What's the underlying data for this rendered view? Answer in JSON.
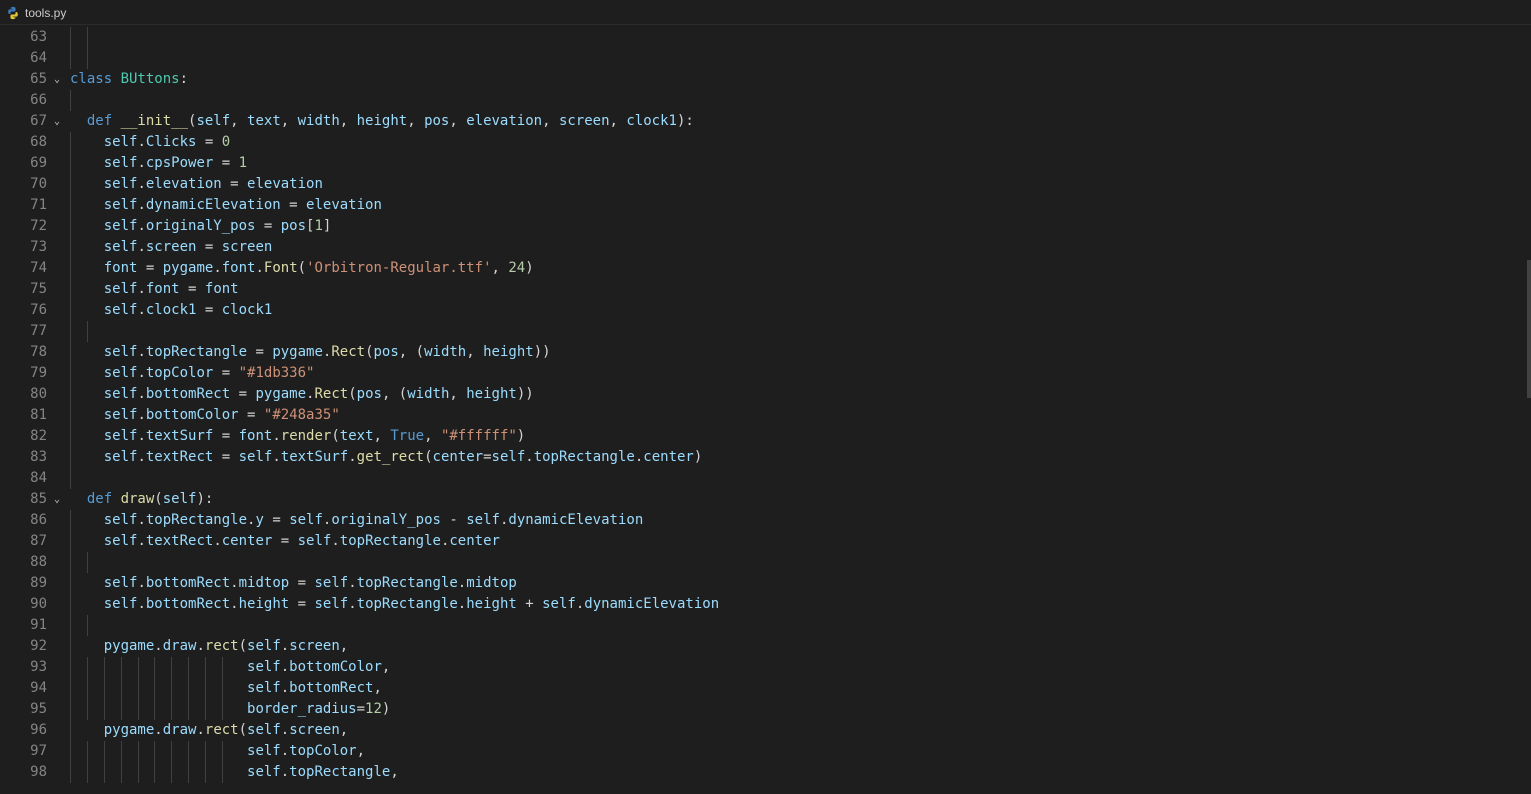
{
  "tab": {
    "filename": "tools.py",
    "icon": "python-icon"
  },
  "colors": {
    "keyword": "#569cd6",
    "class": "#4ec9b0",
    "function": "#dcdcaa",
    "variable": "#9cdcfe",
    "string": "#ce9178",
    "number": "#b5cea8",
    "text": "#d4d4d4",
    "line_number": "#858585"
  },
  "lines": [
    {
      "n": "63",
      "fold": false,
      "tokens": []
    },
    {
      "n": "64",
      "fold": false,
      "tokens": []
    },
    {
      "n": "65",
      "fold": true,
      "tokens": [
        [
          "kw",
          "class "
        ],
        [
          "cls",
          "BUttons"
        ],
        [
          "op",
          ":"
        ]
      ]
    },
    {
      "n": "66",
      "fold": false,
      "tokens": []
    },
    {
      "n": "67",
      "fold": true,
      "tokens": [
        [
          "op",
          "  "
        ],
        [
          "kw",
          "def "
        ],
        [
          "fn",
          "__init__"
        ],
        [
          "op",
          "("
        ],
        [
          "var",
          "self"
        ],
        [
          "op",
          ", "
        ],
        [
          "var",
          "text"
        ],
        [
          "op",
          ", "
        ],
        [
          "var",
          "width"
        ],
        [
          "op",
          ", "
        ],
        [
          "var",
          "height"
        ],
        [
          "op",
          ", "
        ],
        [
          "var",
          "pos"
        ],
        [
          "op",
          ", "
        ],
        [
          "var",
          "elevation"
        ],
        [
          "op",
          ", "
        ],
        [
          "var",
          "screen"
        ],
        [
          "op",
          ", "
        ],
        [
          "var",
          "clock1"
        ],
        [
          "op",
          "):"
        ]
      ]
    },
    {
      "n": "68",
      "fold": false,
      "tokens": [
        [
          "op",
          "    "
        ],
        [
          "var",
          "self"
        ],
        [
          "op",
          "."
        ],
        [
          "var",
          "Clicks"
        ],
        [
          "op",
          " = "
        ],
        [
          "num",
          "0"
        ]
      ]
    },
    {
      "n": "69",
      "fold": false,
      "tokens": [
        [
          "op",
          "    "
        ],
        [
          "var",
          "self"
        ],
        [
          "op",
          "."
        ],
        [
          "var",
          "cpsPower"
        ],
        [
          "op",
          " = "
        ],
        [
          "num",
          "1"
        ]
      ]
    },
    {
      "n": "70",
      "fold": false,
      "tokens": [
        [
          "op",
          "    "
        ],
        [
          "var",
          "self"
        ],
        [
          "op",
          "."
        ],
        [
          "var",
          "elevation"
        ],
        [
          "op",
          " = "
        ],
        [
          "var",
          "elevation"
        ]
      ]
    },
    {
      "n": "71",
      "fold": false,
      "tokens": [
        [
          "op",
          "    "
        ],
        [
          "var",
          "self"
        ],
        [
          "op",
          "."
        ],
        [
          "var",
          "dynamicElevation"
        ],
        [
          "op",
          " = "
        ],
        [
          "var",
          "elevation"
        ]
      ]
    },
    {
      "n": "72",
      "fold": false,
      "tokens": [
        [
          "op",
          "    "
        ],
        [
          "var",
          "self"
        ],
        [
          "op",
          "."
        ],
        [
          "var",
          "originalY_pos"
        ],
        [
          "op",
          " = "
        ],
        [
          "var",
          "pos"
        ],
        [
          "op",
          "["
        ],
        [
          "num",
          "1"
        ],
        [
          "op",
          "]"
        ]
      ]
    },
    {
      "n": "73",
      "fold": false,
      "tokens": [
        [
          "op",
          "    "
        ],
        [
          "var",
          "self"
        ],
        [
          "op",
          "."
        ],
        [
          "var",
          "screen"
        ],
        [
          "op",
          " = "
        ],
        [
          "var",
          "screen"
        ]
      ]
    },
    {
      "n": "74",
      "fold": false,
      "tokens": [
        [
          "op",
          "    "
        ],
        [
          "var",
          "font"
        ],
        [
          "op",
          " = "
        ],
        [
          "var",
          "pygame"
        ],
        [
          "op",
          "."
        ],
        [
          "var",
          "font"
        ],
        [
          "op",
          "."
        ],
        [
          "fn",
          "Font"
        ],
        [
          "op",
          "("
        ],
        [
          "str",
          "'Orbitron-Regular.ttf'"
        ],
        [
          "op",
          ", "
        ],
        [
          "num",
          "24"
        ],
        [
          "op",
          ")"
        ]
      ]
    },
    {
      "n": "75",
      "fold": false,
      "tokens": [
        [
          "op",
          "    "
        ],
        [
          "var",
          "self"
        ],
        [
          "op",
          "."
        ],
        [
          "var",
          "font"
        ],
        [
          "op",
          " = "
        ],
        [
          "var",
          "font"
        ]
      ]
    },
    {
      "n": "76",
      "fold": false,
      "tokens": [
        [
          "op",
          "    "
        ],
        [
          "var",
          "self"
        ],
        [
          "op",
          "."
        ],
        [
          "var",
          "clock1"
        ],
        [
          "op",
          " = "
        ],
        [
          "var",
          "clock1"
        ]
      ]
    },
    {
      "n": "77",
      "fold": false,
      "tokens": []
    },
    {
      "n": "78",
      "fold": false,
      "tokens": [
        [
          "op",
          "    "
        ],
        [
          "var",
          "self"
        ],
        [
          "op",
          "."
        ],
        [
          "var",
          "topRectangle"
        ],
        [
          "op",
          " = "
        ],
        [
          "var",
          "pygame"
        ],
        [
          "op",
          "."
        ],
        [
          "fn",
          "Rect"
        ],
        [
          "op",
          "("
        ],
        [
          "var",
          "pos"
        ],
        [
          "op",
          ", ("
        ],
        [
          "var",
          "width"
        ],
        [
          "op",
          ", "
        ],
        [
          "var",
          "height"
        ],
        [
          "op",
          "))"
        ]
      ]
    },
    {
      "n": "79",
      "fold": false,
      "tokens": [
        [
          "op",
          "    "
        ],
        [
          "var",
          "self"
        ],
        [
          "op",
          "."
        ],
        [
          "var",
          "topColor"
        ],
        [
          "op",
          " = "
        ],
        [
          "str",
          "\"#1db336\""
        ]
      ]
    },
    {
      "n": "80",
      "fold": false,
      "tokens": [
        [
          "op",
          "    "
        ],
        [
          "var",
          "self"
        ],
        [
          "op",
          "."
        ],
        [
          "var",
          "bottomRect"
        ],
        [
          "op",
          " = "
        ],
        [
          "var",
          "pygame"
        ],
        [
          "op",
          "."
        ],
        [
          "fn",
          "Rect"
        ],
        [
          "op",
          "("
        ],
        [
          "var",
          "pos"
        ],
        [
          "op",
          ", ("
        ],
        [
          "var",
          "width"
        ],
        [
          "op",
          ", "
        ],
        [
          "var",
          "height"
        ],
        [
          "op",
          "))"
        ]
      ]
    },
    {
      "n": "81",
      "fold": false,
      "tokens": [
        [
          "op",
          "    "
        ],
        [
          "var",
          "self"
        ],
        [
          "op",
          "."
        ],
        [
          "var",
          "bottomColor"
        ],
        [
          "op",
          " = "
        ],
        [
          "str",
          "\"#248a35\""
        ]
      ]
    },
    {
      "n": "82",
      "fold": false,
      "tokens": [
        [
          "op",
          "    "
        ],
        [
          "var",
          "self"
        ],
        [
          "op",
          "."
        ],
        [
          "var",
          "textSurf"
        ],
        [
          "op",
          " = "
        ],
        [
          "var",
          "font"
        ],
        [
          "op",
          "."
        ],
        [
          "fn",
          "render"
        ],
        [
          "op",
          "("
        ],
        [
          "var",
          "text"
        ],
        [
          "op",
          ", "
        ],
        [
          "bool",
          "True"
        ],
        [
          "op",
          ", "
        ],
        [
          "str",
          "\"#ffffff\""
        ],
        [
          "op",
          ")"
        ]
      ]
    },
    {
      "n": "83",
      "fold": false,
      "tokens": [
        [
          "op",
          "    "
        ],
        [
          "var",
          "self"
        ],
        [
          "op",
          "."
        ],
        [
          "var",
          "textRect"
        ],
        [
          "op",
          " = "
        ],
        [
          "var",
          "self"
        ],
        [
          "op",
          "."
        ],
        [
          "var",
          "textSurf"
        ],
        [
          "op",
          "."
        ],
        [
          "fn",
          "get_rect"
        ],
        [
          "op",
          "("
        ],
        [
          "var",
          "center"
        ],
        [
          "op",
          "="
        ],
        [
          "var",
          "self"
        ],
        [
          "op",
          "."
        ],
        [
          "var",
          "topRectangle"
        ],
        [
          "op",
          "."
        ],
        [
          "var",
          "center"
        ],
        [
          "op",
          ")"
        ]
      ]
    },
    {
      "n": "84",
      "fold": false,
      "tokens": []
    },
    {
      "n": "85",
      "fold": true,
      "tokens": [
        [
          "op",
          "  "
        ],
        [
          "kw",
          "def "
        ],
        [
          "fn",
          "draw"
        ],
        [
          "op",
          "("
        ],
        [
          "var",
          "self"
        ],
        [
          "op",
          "):"
        ]
      ]
    },
    {
      "n": "86",
      "fold": false,
      "tokens": [
        [
          "op",
          "    "
        ],
        [
          "var",
          "self"
        ],
        [
          "op",
          "."
        ],
        [
          "var",
          "topRectangle"
        ],
        [
          "op",
          "."
        ],
        [
          "var",
          "y"
        ],
        [
          "op",
          " = "
        ],
        [
          "var",
          "self"
        ],
        [
          "op",
          "."
        ],
        [
          "var",
          "originalY_pos"
        ],
        [
          "op",
          " - "
        ],
        [
          "var",
          "self"
        ],
        [
          "op",
          "."
        ],
        [
          "var",
          "dynamicElevation"
        ]
      ]
    },
    {
      "n": "87",
      "fold": false,
      "tokens": [
        [
          "op",
          "    "
        ],
        [
          "var",
          "self"
        ],
        [
          "op",
          "."
        ],
        [
          "var",
          "textRect"
        ],
        [
          "op",
          "."
        ],
        [
          "var",
          "center"
        ],
        [
          "op",
          " = "
        ],
        [
          "var",
          "self"
        ],
        [
          "op",
          "."
        ],
        [
          "var",
          "topRectangle"
        ],
        [
          "op",
          "."
        ],
        [
          "var",
          "center"
        ]
      ]
    },
    {
      "n": "88",
      "fold": false,
      "tokens": []
    },
    {
      "n": "89",
      "fold": false,
      "tokens": [
        [
          "op",
          "    "
        ],
        [
          "var",
          "self"
        ],
        [
          "op",
          "."
        ],
        [
          "var",
          "bottomRect"
        ],
        [
          "op",
          "."
        ],
        [
          "var",
          "midtop"
        ],
        [
          "op",
          " = "
        ],
        [
          "var",
          "self"
        ],
        [
          "op",
          "."
        ],
        [
          "var",
          "topRectangle"
        ],
        [
          "op",
          "."
        ],
        [
          "var",
          "midtop"
        ]
      ]
    },
    {
      "n": "90",
      "fold": false,
      "tokens": [
        [
          "op",
          "    "
        ],
        [
          "var",
          "self"
        ],
        [
          "op",
          "."
        ],
        [
          "var",
          "bottomRect"
        ],
        [
          "op",
          "."
        ],
        [
          "var",
          "height"
        ],
        [
          "op",
          " = "
        ],
        [
          "var",
          "self"
        ],
        [
          "op",
          "."
        ],
        [
          "var",
          "topRectangle"
        ],
        [
          "op",
          "."
        ],
        [
          "var",
          "height"
        ],
        [
          "op",
          " + "
        ],
        [
          "var",
          "self"
        ],
        [
          "op",
          "."
        ],
        [
          "var",
          "dynamicElevation"
        ]
      ]
    },
    {
      "n": "91",
      "fold": false,
      "tokens": []
    },
    {
      "n": "92",
      "fold": false,
      "tokens": [
        [
          "op",
          "    "
        ],
        [
          "var",
          "pygame"
        ],
        [
          "op",
          "."
        ],
        [
          "var",
          "draw"
        ],
        [
          "op",
          "."
        ],
        [
          "fn",
          "rect"
        ],
        [
          "op",
          "("
        ],
        [
          "var",
          "self"
        ],
        [
          "op",
          "."
        ],
        [
          "var",
          "screen"
        ],
        [
          "op",
          ","
        ]
      ]
    },
    {
      "n": "93",
      "fold": false,
      "tokens": [
        [
          "op",
          "                     "
        ],
        [
          "var",
          "self"
        ],
        [
          "op",
          "."
        ],
        [
          "var",
          "bottomColor"
        ],
        [
          "op",
          ","
        ]
      ]
    },
    {
      "n": "94",
      "fold": false,
      "tokens": [
        [
          "op",
          "                     "
        ],
        [
          "var",
          "self"
        ],
        [
          "op",
          "."
        ],
        [
          "var",
          "bottomRect"
        ],
        [
          "op",
          ","
        ]
      ]
    },
    {
      "n": "95",
      "fold": false,
      "tokens": [
        [
          "op",
          "                     "
        ],
        [
          "var",
          "border_radius"
        ],
        [
          "op",
          "="
        ],
        [
          "num",
          "12"
        ],
        [
          "op",
          ")"
        ]
      ]
    },
    {
      "n": "96",
      "fold": false,
      "tokens": [
        [
          "op",
          "    "
        ],
        [
          "var",
          "pygame"
        ],
        [
          "op",
          "."
        ],
        [
          "var",
          "draw"
        ],
        [
          "op",
          "."
        ],
        [
          "fn",
          "rect"
        ],
        [
          "op",
          "("
        ],
        [
          "var",
          "self"
        ],
        [
          "op",
          "."
        ],
        [
          "var",
          "screen"
        ],
        [
          "op",
          ","
        ]
      ]
    },
    {
      "n": "97",
      "fold": false,
      "tokens": [
        [
          "op",
          "                     "
        ],
        [
          "var",
          "self"
        ],
        [
          "op",
          "."
        ],
        [
          "var",
          "topColor"
        ],
        [
          "op",
          ","
        ]
      ]
    },
    {
      "n": "98",
      "fold": false,
      "tokens": [
        [
          "op",
          "                     "
        ],
        [
          "var",
          "self"
        ],
        [
          "op",
          "."
        ],
        [
          "var",
          "topRectangle"
        ],
        [
          "op",
          ","
        ]
      ]
    }
  ]
}
